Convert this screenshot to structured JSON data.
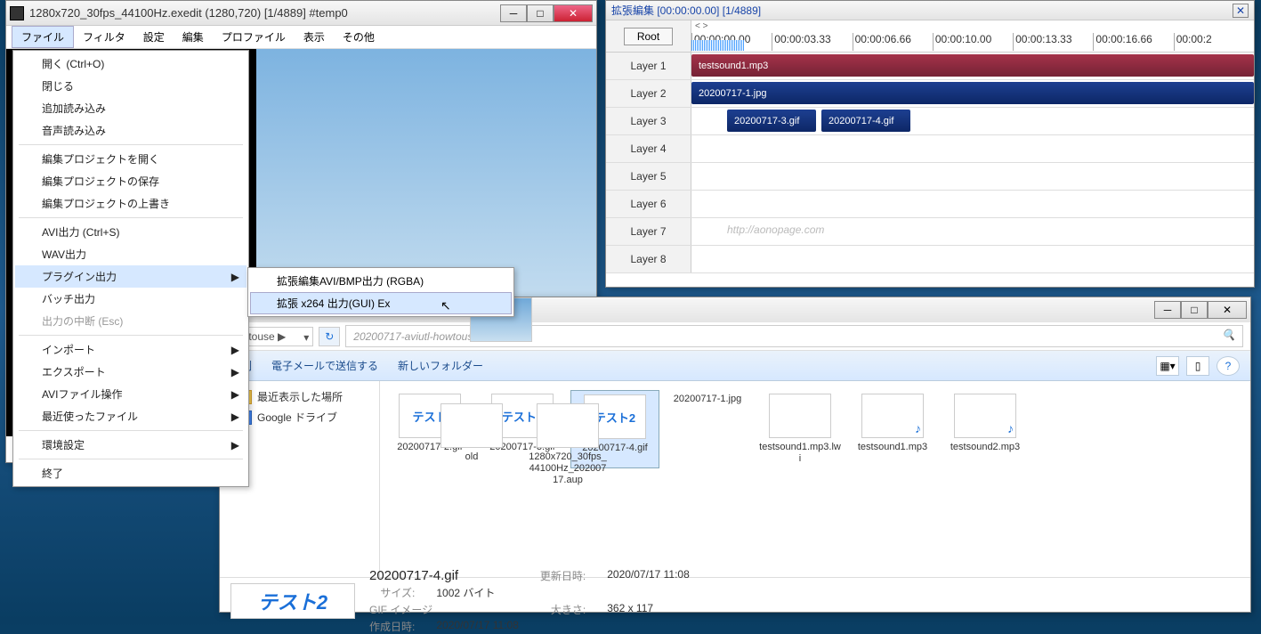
{
  "main": {
    "title": "1280x720_30fps_44100Hz.exedit (1280,720)  [1/4889]  #temp0",
    "menus": [
      "ファイル",
      "フィルタ",
      "設定",
      "編集",
      "プロファイル",
      "表示",
      "その他"
    ]
  },
  "fileMenu": {
    "items": [
      {
        "label": "開く (Ctrl+O)"
      },
      {
        "label": "閉じる"
      },
      {
        "label": "追加読み込み"
      },
      {
        "label": "音声読み込み"
      },
      {
        "sep": true
      },
      {
        "label": "編集プロジェクトを開く"
      },
      {
        "label": "編集プロジェクトの保存"
      },
      {
        "label": "編集プロジェクトの上書き"
      },
      {
        "sep": true
      },
      {
        "label": "AVI出力 (Ctrl+S)"
      },
      {
        "label": "WAV出力"
      },
      {
        "label": "プラグイン出力",
        "sub": true,
        "hover": true
      },
      {
        "label": "バッチ出力"
      },
      {
        "label": "出力の中断 (Esc)",
        "disabled": true
      },
      {
        "sep": true
      },
      {
        "label": "インポート",
        "sub": true
      },
      {
        "label": "エクスポート",
        "sub": true
      },
      {
        "label": "AVIファイル操作",
        "sub": true
      },
      {
        "label": "最近使ったファイル",
        "sub": true
      },
      {
        "sep": true
      },
      {
        "label": "環境設定",
        "sub": true
      },
      {
        "sep": true
      },
      {
        "label": "終了"
      }
    ]
  },
  "subMenu": {
    "items": [
      {
        "label": "拡張編集AVI/BMP出力 (RGBA)"
      },
      {
        "label": "拡張 x264 出力(GUI) Ex",
        "hover": true
      }
    ]
  },
  "timeline": {
    "title": "拡張編集 [00:00:00.00] [1/4889]",
    "root": "Root",
    "zoom": "< >",
    "ticks": [
      "00:00:00.00",
      "00:00:03.33",
      "00:00:06.66",
      "00:00:10.00",
      "00:00:13.33",
      "00:00:16.66",
      "00:00:2"
    ],
    "layers": [
      "Layer 1",
      "Layer 2",
      "Layer 3",
      "Layer 4",
      "Layer 5",
      "Layer 6",
      "Layer 7",
      "Layer 8"
    ],
    "clips": {
      "l1": {
        "name": "testsound1.mp3"
      },
      "l2": {
        "name": "20200717-1.jpg"
      },
      "l3a": {
        "name": "20200717-3.gif"
      },
      "l3b": {
        "name": "20200717-4.gif"
      }
    },
    "watermark": "http://aonopage.com"
  },
  "explorer": {
    "crumb": "owtouse ▶",
    "searchPlaceholder": "20200717-aviutl-howtouseの...",
    "toolbar": [
      "印刷",
      "電子メールで送信する",
      "新しいフォルダー"
    ],
    "sideitems": [
      "最近表示した場所",
      "Google ドライブ"
    ],
    "stray": {
      "name1": "old",
      "name2": "1280x720_30fps_44100Hz_20200717.aup"
    },
    "files": [
      {
        "thumb": "テスト",
        "name": "20200717-2.gif"
      },
      {
        "thumb": "テスト1",
        "name": "20200717-3.gif"
      },
      {
        "thumb": "テスト2",
        "name": "20200717-4.gif",
        "selected": true
      },
      {
        "thumb": "",
        "name": "20200717-1.jpg",
        "sky": true
      },
      {
        "thumb": "",
        "name": "testsound1.mp3.lwi",
        "file": true
      },
      {
        "thumb": "",
        "name": "testsound1.mp3",
        "media": true
      },
      {
        "thumb": "",
        "name": "testsound2.mp3",
        "media": true
      }
    ],
    "details": {
      "thumb": "テスト2",
      "filename": "20200717-4.gif",
      "type": "GIF イメージ",
      "mod_k": "更新日時:",
      "mod_v": "2020/07/17 11:08",
      "dim_k": "大きさ:",
      "dim_v": "362 x 117",
      "size_k": "サイズ:",
      "size_v": "1002 バイト",
      "create_k": "作成日時:",
      "create_v": "2020/07/17 11:08"
    }
  }
}
